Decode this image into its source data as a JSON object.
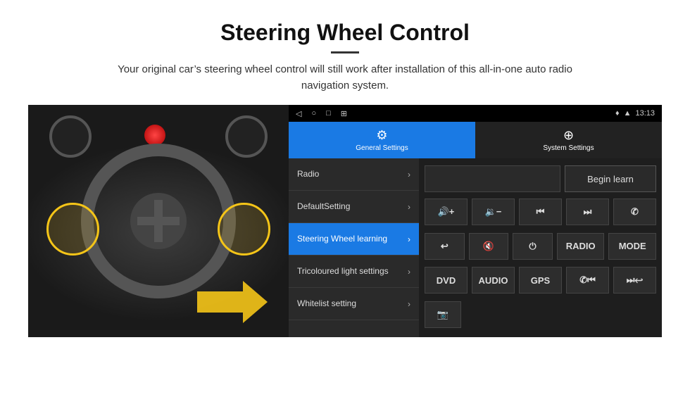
{
  "header": {
    "title": "Steering Wheel Control",
    "divider": true,
    "subtitle": "Your original car’s steering wheel control will still work after installation of this all-in-one auto radio navigation system."
  },
  "status_bar": {
    "nav_icons": [
      "◁",
      "○",
      "□",
      "⊞"
    ],
    "right": {
      "location": "♥",
      "wifi": "▲",
      "time": "13:13"
    }
  },
  "tabs": [
    {
      "id": "general",
      "label": "General Settings",
      "icon": "⚙",
      "active": true
    },
    {
      "id": "system",
      "label": "System Settings",
      "icon": "⊕",
      "active": false
    }
  ],
  "menu_items": [
    {
      "id": "radio",
      "label": "Radio",
      "active": false
    },
    {
      "id": "default",
      "label": "DefaultSetting",
      "active": false
    },
    {
      "id": "steering",
      "label": "Steering Wheel learning",
      "active": true
    },
    {
      "id": "tricoloured",
      "label": "Tricoloured light settings",
      "active": false
    },
    {
      "id": "whitelist",
      "label": "Whitelist setting",
      "active": false
    }
  ],
  "right_panel": {
    "begin_learn_label": "Begin learn",
    "row1": [
      {
        "id": "vol_up",
        "label": "🔊+",
        "icon": "vol-up-icon"
      },
      {
        "id": "vol_down",
        "label": "🔉−",
        "icon": "vol-down-icon"
      },
      {
        "id": "prev",
        "label": "⏮",
        "icon": "prev-icon"
      },
      {
        "id": "next",
        "label": "⏭",
        "icon": "next-icon"
      },
      {
        "id": "phone",
        "label": "✆",
        "icon": "phone-icon"
      }
    ],
    "row2": [
      {
        "id": "back",
        "label": "↩",
        "icon": "back-icon"
      },
      {
        "id": "mute",
        "label": "🔇×",
        "icon": "mute-icon"
      },
      {
        "id": "power",
        "label": "⏻",
        "icon": "power-icon"
      },
      {
        "id": "radio_btn",
        "label": "RADIO",
        "icon": "radio-icon"
      },
      {
        "id": "mode",
        "label": "MODE",
        "icon": "mode-icon"
      }
    ],
    "row3": [
      {
        "id": "dvd",
        "label": "DVD",
        "icon": "dvd-icon"
      },
      {
        "id": "audio",
        "label": "AUDIO",
        "icon": "audio-icon"
      },
      {
        "id": "gps",
        "label": "GPS",
        "icon": "gps-icon"
      },
      {
        "id": "phone2",
        "label": "✆⏮",
        "icon": "phone-prev-icon"
      },
      {
        "id": "skip_next",
        "label": "⏭",
        "icon": "skip-next-icon"
      }
    ],
    "row4": [
      {
        "id": "camera",
        "label": "📷",
        "icon": "camera-icon"
      }
    ]
  }
}
